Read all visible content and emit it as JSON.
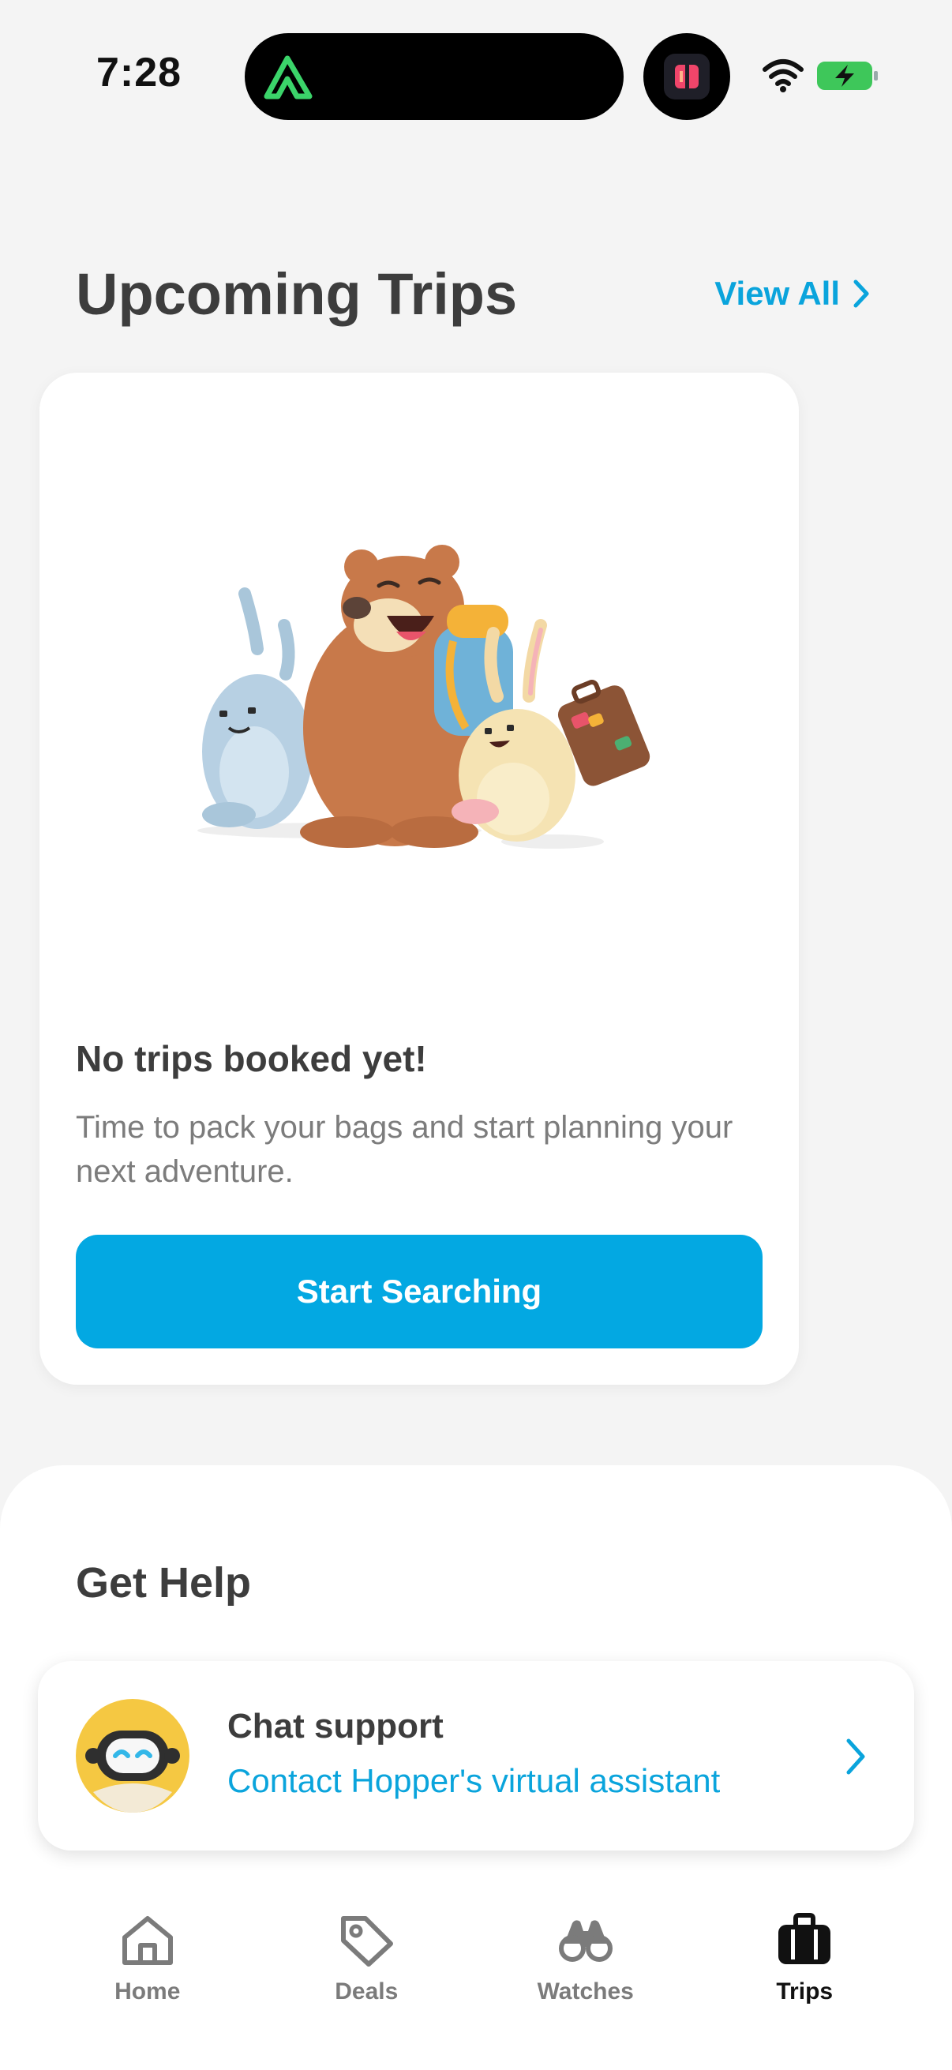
{
  "status_bar": {
    "time": "7:28",
    "icons": [
      "app-activity-logo-icon",
      "app-notification-icon",
      "wifi-icon",
      "battery-charging-icon"
    ]
  },
  "header": {
    "title": "Upcoming Trips",
    "view_all_label": "View All"
  },
  "empty_state": {
    "illustration": "travel-animals-illustration",
    "title": "No trips booked yet!",
    "description": "Time to pack your bags and start planning your next adventure.",
    "button_label": "Start Searching"
  },
  "help": {
    "title": "Get Help",
    "chat": {
      "title": "Chat support",
      "subtitle": "Contact Hopper's virtual assistant"
    }
  },
  "tabs": [
    {
      "label": "Home",
      "icon": "home-icon",
      "active": false
    },
    {
      "label": "Deals",
      "icon": "tag-icon",
      "active": false
    },
    {
      "label": "Watches",
      "icon": "binoculars-icon",
      "active": false
    },
    {
      "label": "Trips",
      "icon": "suitcase-icon",
      "active": true
    }
  ],
  "colors": {
    "accent": "#03a8e2",
    "link": "#0aa4dc",
    "background": "#f4f4f4"
  }
}
